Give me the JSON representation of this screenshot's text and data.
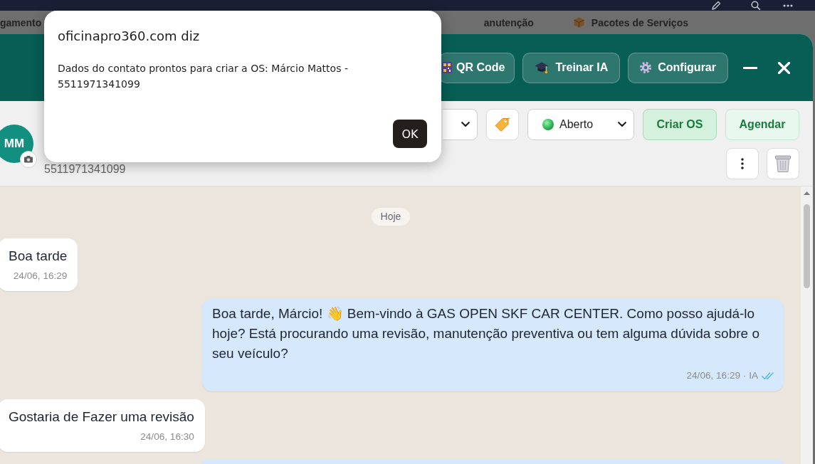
{
  "page_nav": {
    "items": [
      {
        "label": "gamento"
      },
      {
        "label": "anutenção"
      },
      {
        "label": "Pacotes de Serviços"
      }
    ]
  },
  "chat_window": {
    "header_buttons": [
      {
        "label": "QR Code"
      },
      {
        "label": "Treinar IA"
      },
      {
        "label": "Configurar"
      }
    ],
    "contact": {
      "avatar_initials": "MM",
      "phone": "5511971341099"
    },
    "toolbar": {
      "status_select": {
        "value": "Aberto"
      },
      "actions": [
        {
          "label": "Criar OS",
          "kind": "primary"
        },
        {
          "label": "Agendar",
          "kind": "secondary"
        }
      ]
    },
    "day_divider": "Hoje",
    "messages": [
      {
        "kind": "incoming",
        "text": "Boa tarde",
        "time": "24/06, 16:29"
      },
      {
        "kind": "outgoing",
        "text": "Boa tarde, Márcio! 👋 Bem-vindo à GAS OPEN SKF CAR CENTER. Como posso ajudá-lo hoje? Está procurando uma revisão, manutenção preventiva ou tem alguma dúvida sobre o seu veículo?",
        "time": "24/06, 16:29 · IA",
        "read": true
      },
      {
        "kind": "incoming",
        "text": "Gostaria de Fazer uma revisão",
        "time": "24/06, 16:30"
      },
      {
        "kind": "outgoing"
      }
    ]
  },
  "dialog": {
    "title": "oficinapro360.com diz",
    "message": "Dados do contato prontos para criar a OS: Márcio Mattos - 5511971341099",
    "button": "OK"
  }
}
